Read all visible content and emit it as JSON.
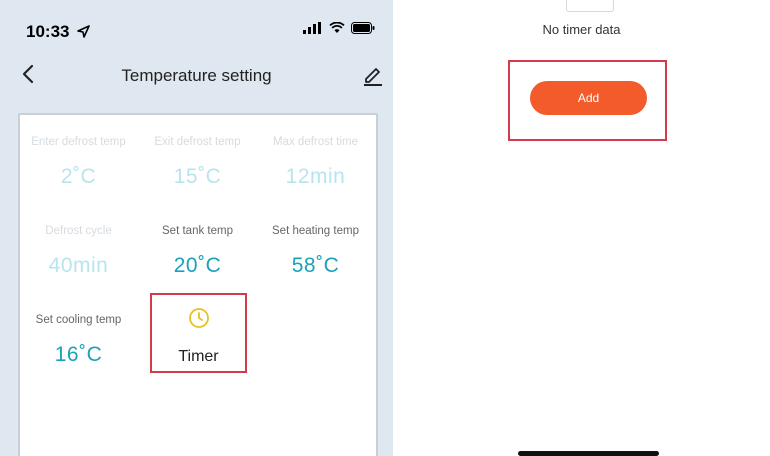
{
  "status_bar": {
    "time": "10:33"
  },
  "nav": {
    "title": "Temperature setting"
  },
  "settings": [
    {
      "label": "Enter defrost temp",
      "value": "2˚C",
      "faded": true
    },
    {
      "label": "Exit defrost temp",
      "value": "15˚C",
      "faded": true
    },
    {
      "label": "Max defrost time",
      "value": "12min",
      "faded": true
    },
    {
      "label": "Defrost cycle",
      "value": "40min",
      "faded": true
    },
    {
      "label": "Set tank temp",
      "value": "20˚C",
      "faded": false
    },
    {
      "label": "Set heating temp",
      "value": "58˚C",
      "faded": false
    },
    {
      "label": "Set cooling temp",
      "value": "16˚C",
      "faded": false
    }
  ],
  "timer": {
    "label": "Timer",
    "icon": "clock-icon"
  },
  "right": {
    "empty_text": "No timer data",
    "add_label": "Add"
  },
  "colors": {
    "accent_orange": "#f35b2a",
    "value_teal": "#1aa2b8",
    "highlight_red": "#d33a4a",
    "clock_yellow": "#e8c21f",
    "page_bg": "#dfe8f1"
  }
}
